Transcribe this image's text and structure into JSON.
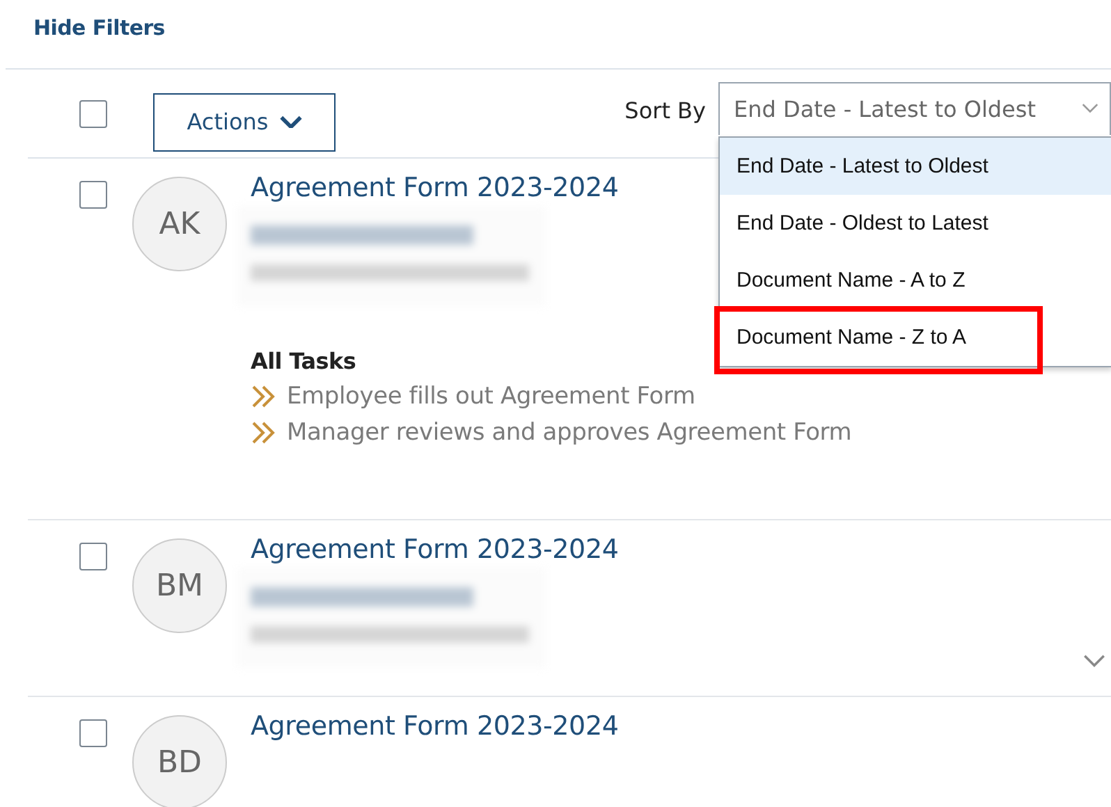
{
  "filters_link": "Hide Filters",
  "toolbar": {
    "select_all": {
      "checked": false
    },
    "actions_button": "Actions",
    "sort_label": "Sort By",
    "sort_value": "End Date - Latest to Oldest"
  },
  "sort_menu": {
    "expanded": true,
    "options": [
      {
        "label": "End Date - Latest to Oldest",
        "selected": true,
        "highlighted": false
      },
      {
        "label": "End Date - Oldest to Latest",
        "selected": false,
        "highlighted": false
      },
      {
        "label": "Document Name - A to Z",
        "selected": false,
        "highlighted": false
      },
      {
        "label": "Document Name - Z to A",
        "selected": false,
        "highlighted": true
      }
    ]
  },
  "cards": [
    {
      "checked": false,
      "initials": "AK",
      "title": "Agreement Form 2023-2024",
      "redacted": true,
      "expanded": true,
      "tasks_heading": "All Tasks",
      "tasks": [
        "Employee fills out Agreement Form",
        "Manager reviews and approves Agreement Form"
      ]
    },
    {
      "checked": false,
      "initials": "BM",
      "title": "Agreement Form 2023-2024",
      "redacted": true,
      "expanded": false
    },
    {
      "checked": false,
      "initials": "BD",
      "title": "Agreement Form 2023-2024"
    }
  ]
}
